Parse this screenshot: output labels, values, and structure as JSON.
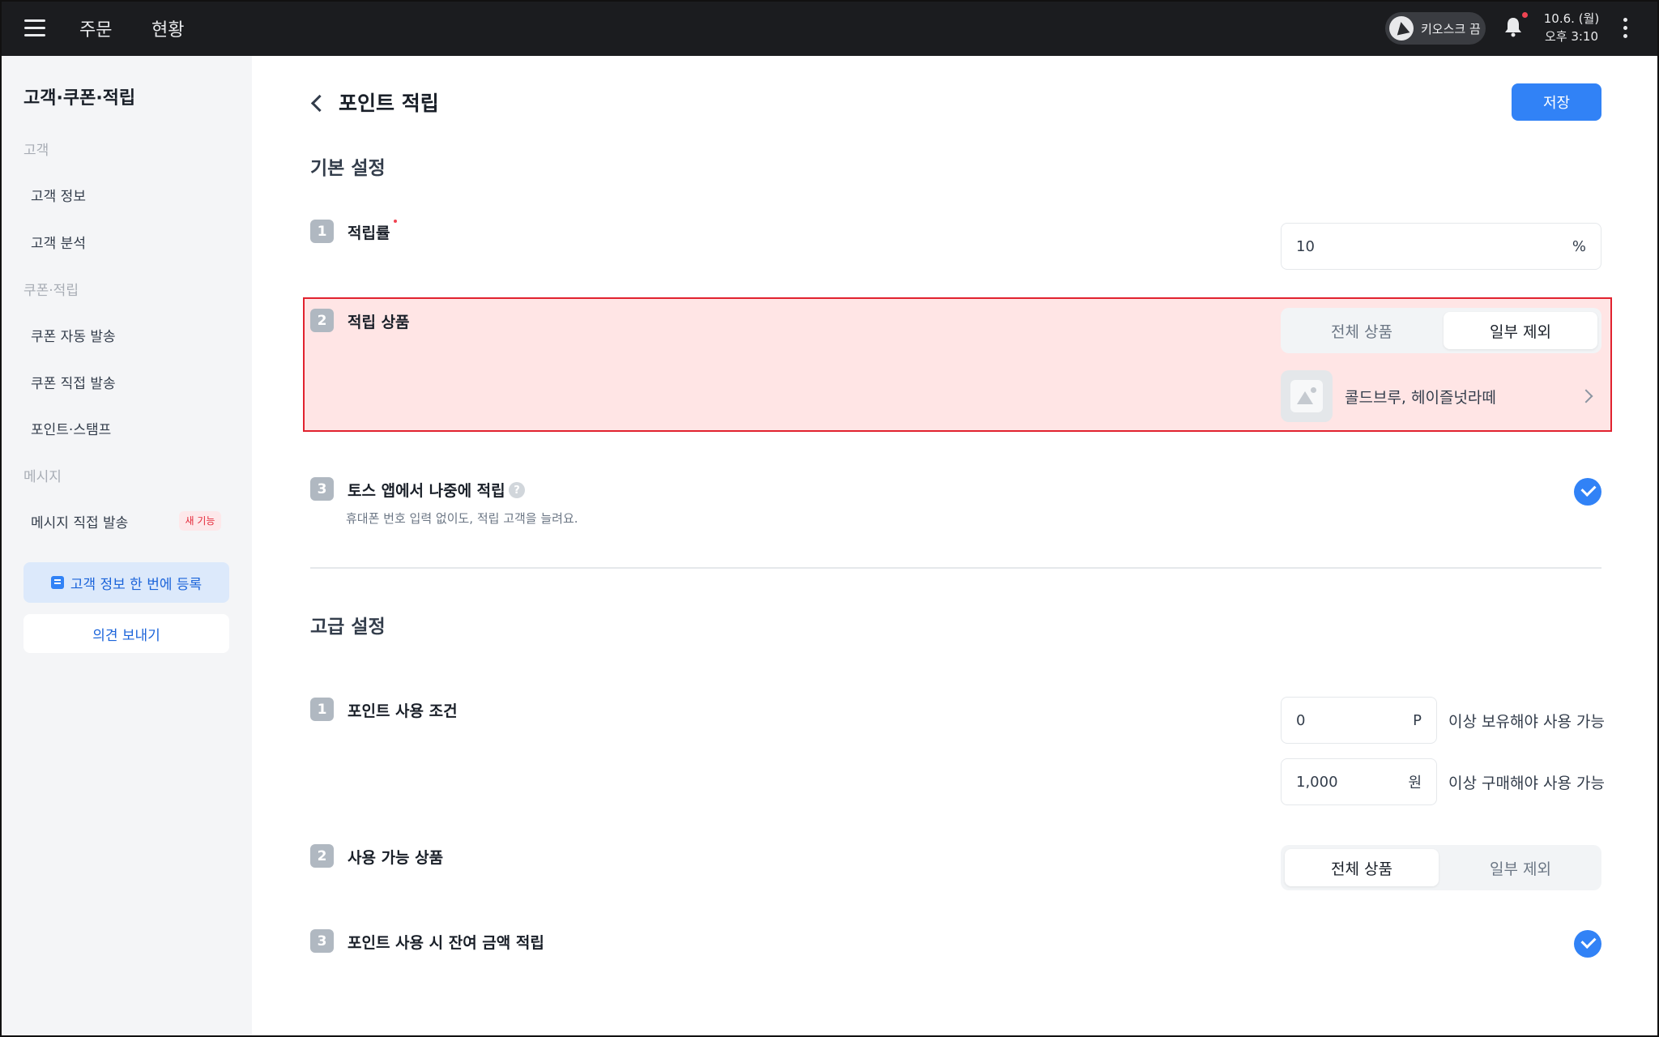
{
  "topbar": {
    "nav": [
      "주문",
      "현황"
    ],
    "kiosk_label": "키오스크 끔",
    "date": "10.6. (월)",
    "time": "오후 3:10"
  },
  "sidebar": {
    "title": "고객·쿠폰·적립",
    "sections": [
      {
        "label": "고객",
        "items": [
          "고객 정보",
          "고객 분석"
        ]
      },
      {
        "label": "쿠폰·적립",
        "items": [
          "쿠폰 자동 발송",
          "쿠폰 직접 발송",
          "포인트·스탬프"
        ]
      },
      {
        "label": "메시지",
        "items": [
          "메시지 직접 발송"
        ]
      }
    ],
    "new_badge": "새 기능",
    "register_button": "고객 정보 한 번에 등록",
    "feedback_button": "의견 보내기"
  },
  "main": {
    "title": "포인트 적립",
    "save_label": "저장",
    "basic": {
      "title": "기본 설정",
      "rate": {
        "num": "1",
        "label": "적립률",
        "value": "10",
        "unit": "%"
      },
      "products": {
        "num": "2",
        "label": "적립 상품",
        "options": [
          "전체 상품",
          "일부 제외"
        ],
        "selected": "일부 제외",
        "excluded": "콜드브루, 헤이즐넛라떼"
      },
      "toss": {
        "num": "3",
        "label": "토스 앱에서 나중에 적립",
        "help": "?",
        "description": "휴대폰 번호 입력 없이도, 적립 고객을 늘려요.",
        "checked": true
      }
    },
    "advanced": {
      "title": "고급 설정",
      "condition": {
        "num": "1",
        "label": "포인트 사용 조건",
        "points_value": "0",
        "points_unit": "P",
        "points_text": "이상 보유해야 사용 가능",
        "purchase_value": "1,000",
        "purchase_unit": "원",
        "purchase_text": "이상 구매해야 사용 가능"
      },
      "usable": {
        "num": "2",
        "label": "사용 가능 상품",
        "options": [
          "전체 상품",
          "일부 제외"
        ],
        "selected": "전체 상품"
      },
      "remainder": {
        "num": "3",
        "label": "포인트 사용 시 잔여 금액 적립",
        "checked": true
      }
    }
  },
  "colors": {
    "accent": "#3182f6",
    "highlight_border": "#e1222f",
    "topbar": "#1b1c1f",
    "sidebar": "#f4f5f7"
  }
}
